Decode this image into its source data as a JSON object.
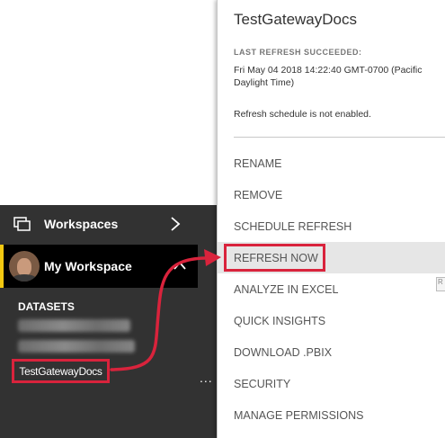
{
  "nav": {
    "workspaces_label": "Workspaces",
    "my_workspace_label": "My Workspace",
    "datasets_header": "DATASETS",
    "dataset_selected": "TestGatewayDocs",
    "more_options": "..."
  },
  "menu": {
    "title": "TestGatewayDocs",
    "refresh_status": "LAST REFRESH SUCCEEDED:",
    "refresh_time": "Fri May 04 2018 14:22:40 GMT-0700 (Pacific Daylight Time)",
    "schedule_note": "Refresh schedule is not enabled.",
    "items": [
      {
        "label": "RENAME"
      },
      {
        "label": "REMOVE"
      },
      {
        "label": "SCHEDULE REFRESH"
      },
      {
        "label": "REFRESH NOW"
      },
      {
        "label": "ANALYZE IN EXCEL"
      },
      {
        "label": "QUICK INSIGHTS"
      },
      {
        "label": "DOWNLOAD .PBIX"
      },
      {
        "label": "SECURITY"
      },
      {
        "label": "MANAGE PERMISSIONS"
      }
    ],
    "edge_badge": "R"
  },
  "colors": {
    "nav_bg": "#323232",
    "active_bar": "#f2c811",
    "highlight_red": "#d9233c",
    "hover_bg": "#e6e6e6"
  },
  "icons": {
    "workspaces": "workspaces-icon",
    "expand": "chevron-right-icon",
    "collapse": "chevron-up-icon",
    "avatar": "user-avatar"
  }
}
